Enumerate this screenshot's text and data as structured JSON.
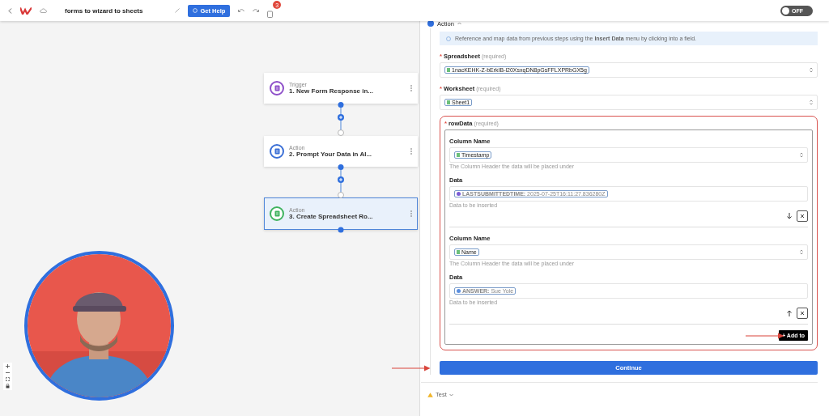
{
  "toolbar": {
    "title": "forms to wizard to sheets",
    "help_button": "Get Help",
    "notification_count": "3",
    "toggle": {
      "label": "OFF",
      "on": false
    }
  },
  "flow": {
    "steps": [
      {
        "type_label": "Trigger",
        "title": "1. New Form Response in...",
        "color": "#8e4fc9",
        "selected": false
      },
      {
        "type_label": "Action",
        "title": "2. Prompt Your Data in AI...",
        "color": "#3b6fd6",
        "selected": false
      },
      {
        "type_label": "Action",
        "title": "3. Create Spreadsheet Ro...",
        "color": "#3fb35f",
        "selected": true
      }
    ]
  },
  "panel": {
    "section": {
      "title": "Action",
      "expanded": true
    },
    "info": "Reference and map data from previous steps using the **Insert Data** menu by clicking into a field.",
    "fields": [
      {
        "asterisk": "*",
        "label": "Spreadsheet",
        "note": "(required)",
        "chip": "1nacKEHK-Z-bErkIB-l20XsxqDN8pGsFFLXPRbGX5g"
      },
      {
        "asterisk": "*",
        "label": "Worksheet",
        "note": "(required)",
        "chip": "Sheet1"
      }
    ],
    "row_data": {
      "asterisk": "*",
      "label": "rowData",
      "note": "(required)",
      "rows": [
        {
          "column_label": "Column Name",
          "column_chip": "Timestamp",
          "column_hint": "The Column Header the data will be placed under",
          "data_label": "Data",
          "data_chip": "**LASTSUBMITTEDTIME:** 2025-07-25T16:11:27.836280Z",
          "color": "#7b5cd6",
          "data_hint": "Data to be inserted",
          "kind": "down"
        },
        {
          "column_label": "Column Name",
          "column_chip": "Name",
          "column_hint": "The Column Header the data will be placed under",
          "data_label": "Data",
          "data_chip": "**ANSWER:** Sue Yole",
          "color": "#5b8fe0",
          "data_hint": "Data to be inserted",
          "kind": "up"
        }
      ],
      "add_button": "+ Add to"
    },
    "continue_button": "Continue",
    "test": {
      "label": "Test",
      "expanded": false
    }
  }
}
